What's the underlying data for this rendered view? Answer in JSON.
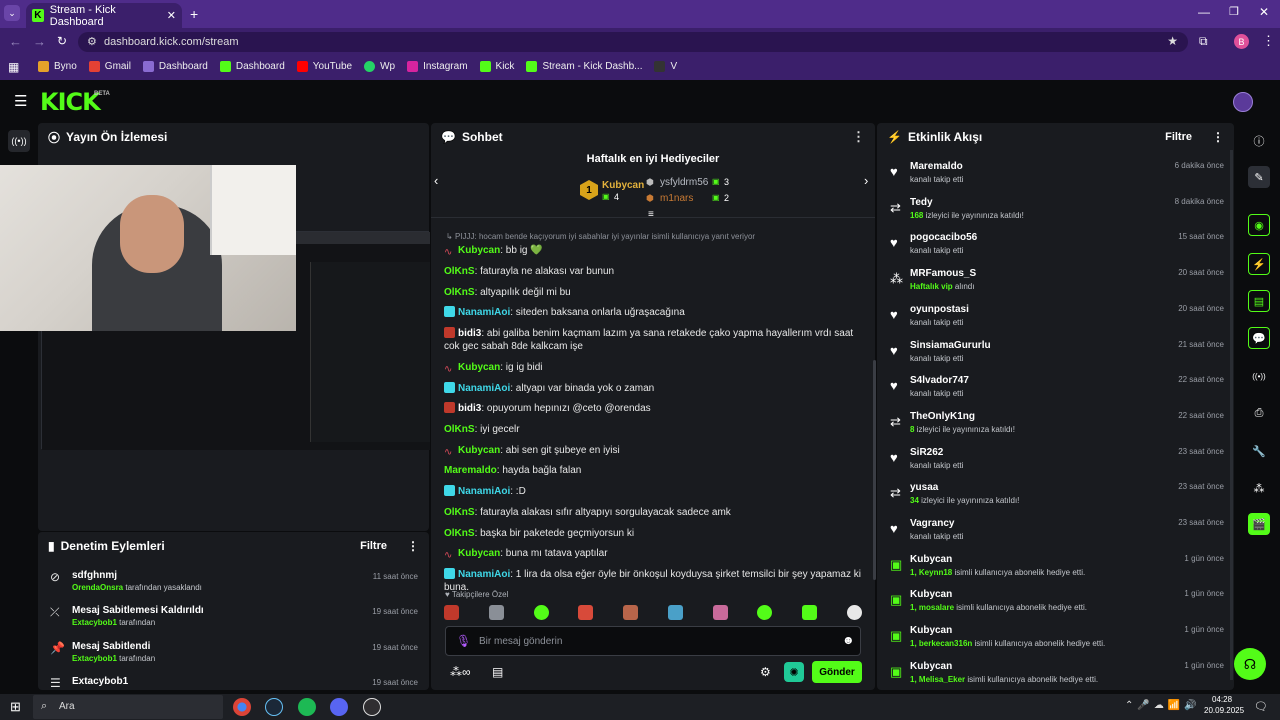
{
  "browser": {
    "tab_title": "Stream - Kick Dashboard",
    "url": "dashboard.kick.com/stream",
    "profile_initial": "B",
    "bookmarks": [
      "Byno",
      "Gmail",
      "Dashboard",
      "Dashboard",
      "YouTube",
      "Wp",
      "Instagram",
      "Kick",
      "Stream - Kick Dashb...",
      "V"
    ]
  },
  "kick": {
    "logo": "KICK",
    "beta": "BETA"
  },
  "preview": {
    "title": "Yayın Ön İzlemesi"
  },
  "moderation": {
    "title": "Denetim Eylemleri",
    "filter": "Filtre",
    "items": [
      {
        "name": "sdfghnmj",
        "actor": "OrendaOnsra",
        "suffix": " tarafından yasaklandı",
        "time": "11 saat önce"
      },
      {
        "name": "Mesaj Sabitlemesi Kaldırıldı",
        "actor": "Extacybob1",
        "suffix": " tarafından",
        "time": "19 saat önce"
      },
      {
        "name": "Mesaj Sabitlendi",
        "actor": "Extacybob1",
        "suffix": " tarafından",
        "time": "19 saat önce"
      },
      {
        "name": "Extacybob1",
        "actor": "",
        "suffix": "",
        "time": "19 saat önce"
      }
    ]
  },
  "chat": {
    "title": "Sohbet",
    "gifters_title": "Haftalık en iyi Hediyeciler",
    "gifters": [
      {
        "rank": "1",
        "name": "Kubycan",
        "count": "4"
      },
      {
        "rank": "",
        "name": "ysfyldrm56",
        "count": "3"
      },
      {
        "rank": "",
        "name": "m1nars",
        "count": "2"
      }
    ],
    "reply_note": "PIJJJ: hocam bende kaçıyorum iyi sabahlar iyi yayınlar isimli kullanıcıya yanıt veriyor",
    "messages": [
      {
        "user": "Kubycan",
        "text": " bb ig 💚",
        "color": "#53fc18"
      },
      {
        "user": "OlKnS",
        "text": " faturayla ne alakası var bunun",
        "color": "#53fc18"
      },
      {
        "user": "OlKnS",
        "text": " altyapılık değil mi bu",
        "color": "#53fc18"
      },
      {
        "user": "NanamiAoi",
        "text": " siteden baksana onlarla uğraşacağına",
        "color": "#3fd8e8"
      },
      {
        "user": "bidi3",
        "text": " abi galiba benim kaçmam lazım ya sana retakede çako yapma hayallerım vrdı saat cok gec sabah 8de kalkcam işe",
        "color": "#ffffff"
      },
      {
        "user": "Kubycan",
        "text": " ig ig bidi",
        "color": "#53fc18"
      },
      {
        "user": "NanamiAoi",
        "text": " altyapı var binada yok o zaman",
        "color": "#3fd8e8"
      },
      {
        "user": "bidi3",
        "text": " opuyorum hepınızı @ceto @orendas",
        "color": "#ffffff"
      },
      {
        "user": "OlKnS",
        "text": " iyi gecelr",
        "color": "#53fc18"
      },
      {
        "user": "Kubycan",
        "text": " abi sen git şubeye en iyisi",
        "color": "#53fc18"
      },
      {
        "user": "Maremaldo",
        "text": " hayda bağla falan",
        "color": "#53fc18"
      },
      {
        "user": "NanamiAoi",
        "text": " :D",
        "color": "#3fd8e8"
      },
      {
        "user": "OlKnS",
        "text": " faturayla alakası sıfır altyapıyı sorgulayacak sadece amk",
        "color": "#53fc18"
      },
      {
        "user": "OlKnS",
        "text": " başka bir paketede geçmiyorsun ki",
        "color": "#53fc18"
      },
      {
        "user": "Kubycan",
        "text": " buna mı tatava yaptılar",
        "color": "#53fc18"
      },
      {
        "user": "NanamiAoi",
        "text": " 1 lira da olsa eğer öyle bir önkoşul koyduysa şirket temsilci bir şey yapamaz ki buna.",
        "color": "#3fd8e8"
      }
    ],
    "followers_only": "Takipçilere Özel",
    "input_placeholder": "Bir mesaj gönderin",
    "send": "Gönder"
  },
  "events": {
    "title": "Etkinlik Akışı",
    "filter": "Filtre",
    "items": [
      {
        "icon": "heart",
        "name": "Maremaldo",
        "pre": "",
        "hl": "",
        "desc": "kanalı takip etti",
        "time": "6 dakika önce"
      },
      {
        "icon": "raid",
        "name": "Tedy",
        "pre": "",
        "hl": "168",
        "desc": " izleyici ile yayınınıza katıldı!",
        "time": "8 dakika önce"
      },
      {
        "icon": "heart",
        "name": "pogocacibo56",
        "pre": "",
        "hl": "",
        "desc": "kanalı takip etti",
        "time": "15 saat önce"
      },
      {
        "icon": "vip",
        "name": "MRFamous_S",
        "pre": "",
        "hl": "Haftalık vip",
        "desc": " alındı",
        "time": "20 saat önce"
      },
      {
        "icon": "heart",
        "name": "oyunpostasi",
        "pre": "",
        "hl": "",
        "desc": "kanalı takip etti",
        "time": "20 saat önce"
      },
      {
        "icon": "heart",
        "name": "SinsiamaGururlu",
        "pre": "",
        "hl": "",
        "desc": "kanalı takip etti",
        "time": "21 saat önce"
      },
      {
        "icon": "heart",
        "name": "S4lvador747",
        "pre": "",
        "hl": "",
        "desc": "kanalı takip etti",
        "time": "22 saat önce"
      },
      {
        "icon": "raid",
        "name": "TheOnlyK1ng",
        "pre": "",
        "hl": "8",
        "desc": " izleyici ile yayınınıza katıldı!",
        "time": "22 saat önce"
      },
      {
        "icon": "heart",
        "name": "SiR262",
        "pre": "",
        "hl": "",
        "desc": "kanalı takip etti",
        "time": "23 saat önce"
      },
      {
        "icon": "raid",
        "name": "yusaa",
        "pre": "",
        "hl": "34",
        "desc": " izleyici ile yayınınıza katıldı!",
        "time": "23 saat önce"
      },
      {
        "icon": "heart",
        "name": "Vagrancy",
        "pre": "",
        "hl": "",
        "desc": "kanalı takip etti",
        "time": "23 saat önce"
      },
      {
        "icon": "gift",
        "name": "Kubycan",
        "pre": "1, ",
        "hl": "Keynn18",
        "desc": " isimli kullanıcıya abonelik hediye etti.",
        "time": "1 gün önce"
      },
      {
        "icon": "gift",
        "name": "Kubycan",
        "pre": "1, ",
        "hl": "mosalare",
        "desc": " isimli kullanıcıya abonelik hediye etti.",
        "time": "1 gün önce"
      },
      {
        "icon": "gift",
        "name": "Kubycan",
        "pre": "1, ",
        "hl": "berkecan316n",
        "desc": " isimli kullanıcıya abonelik hediye etti.",
        "time": "1 gün önce"
      },
      {
        "icon": "gift",
        "name": "Kubycan",
        "pre": "1, ",
        "hl": "Melisa_Eker",
        "desc": " isimli kullanıcıya abonelik hediye etti.",
        "time": "1 gün önce"
      }
    ]
  },
  "taskbar": {
    "search": "Ara",
    "time": "04:28",
    "date": "20.09.2025"
  },
  "colors": {
    "accent": "#53fc18",
    "panel": "#191b1f",
    "browser": "#3b1f6b"
  }
}
